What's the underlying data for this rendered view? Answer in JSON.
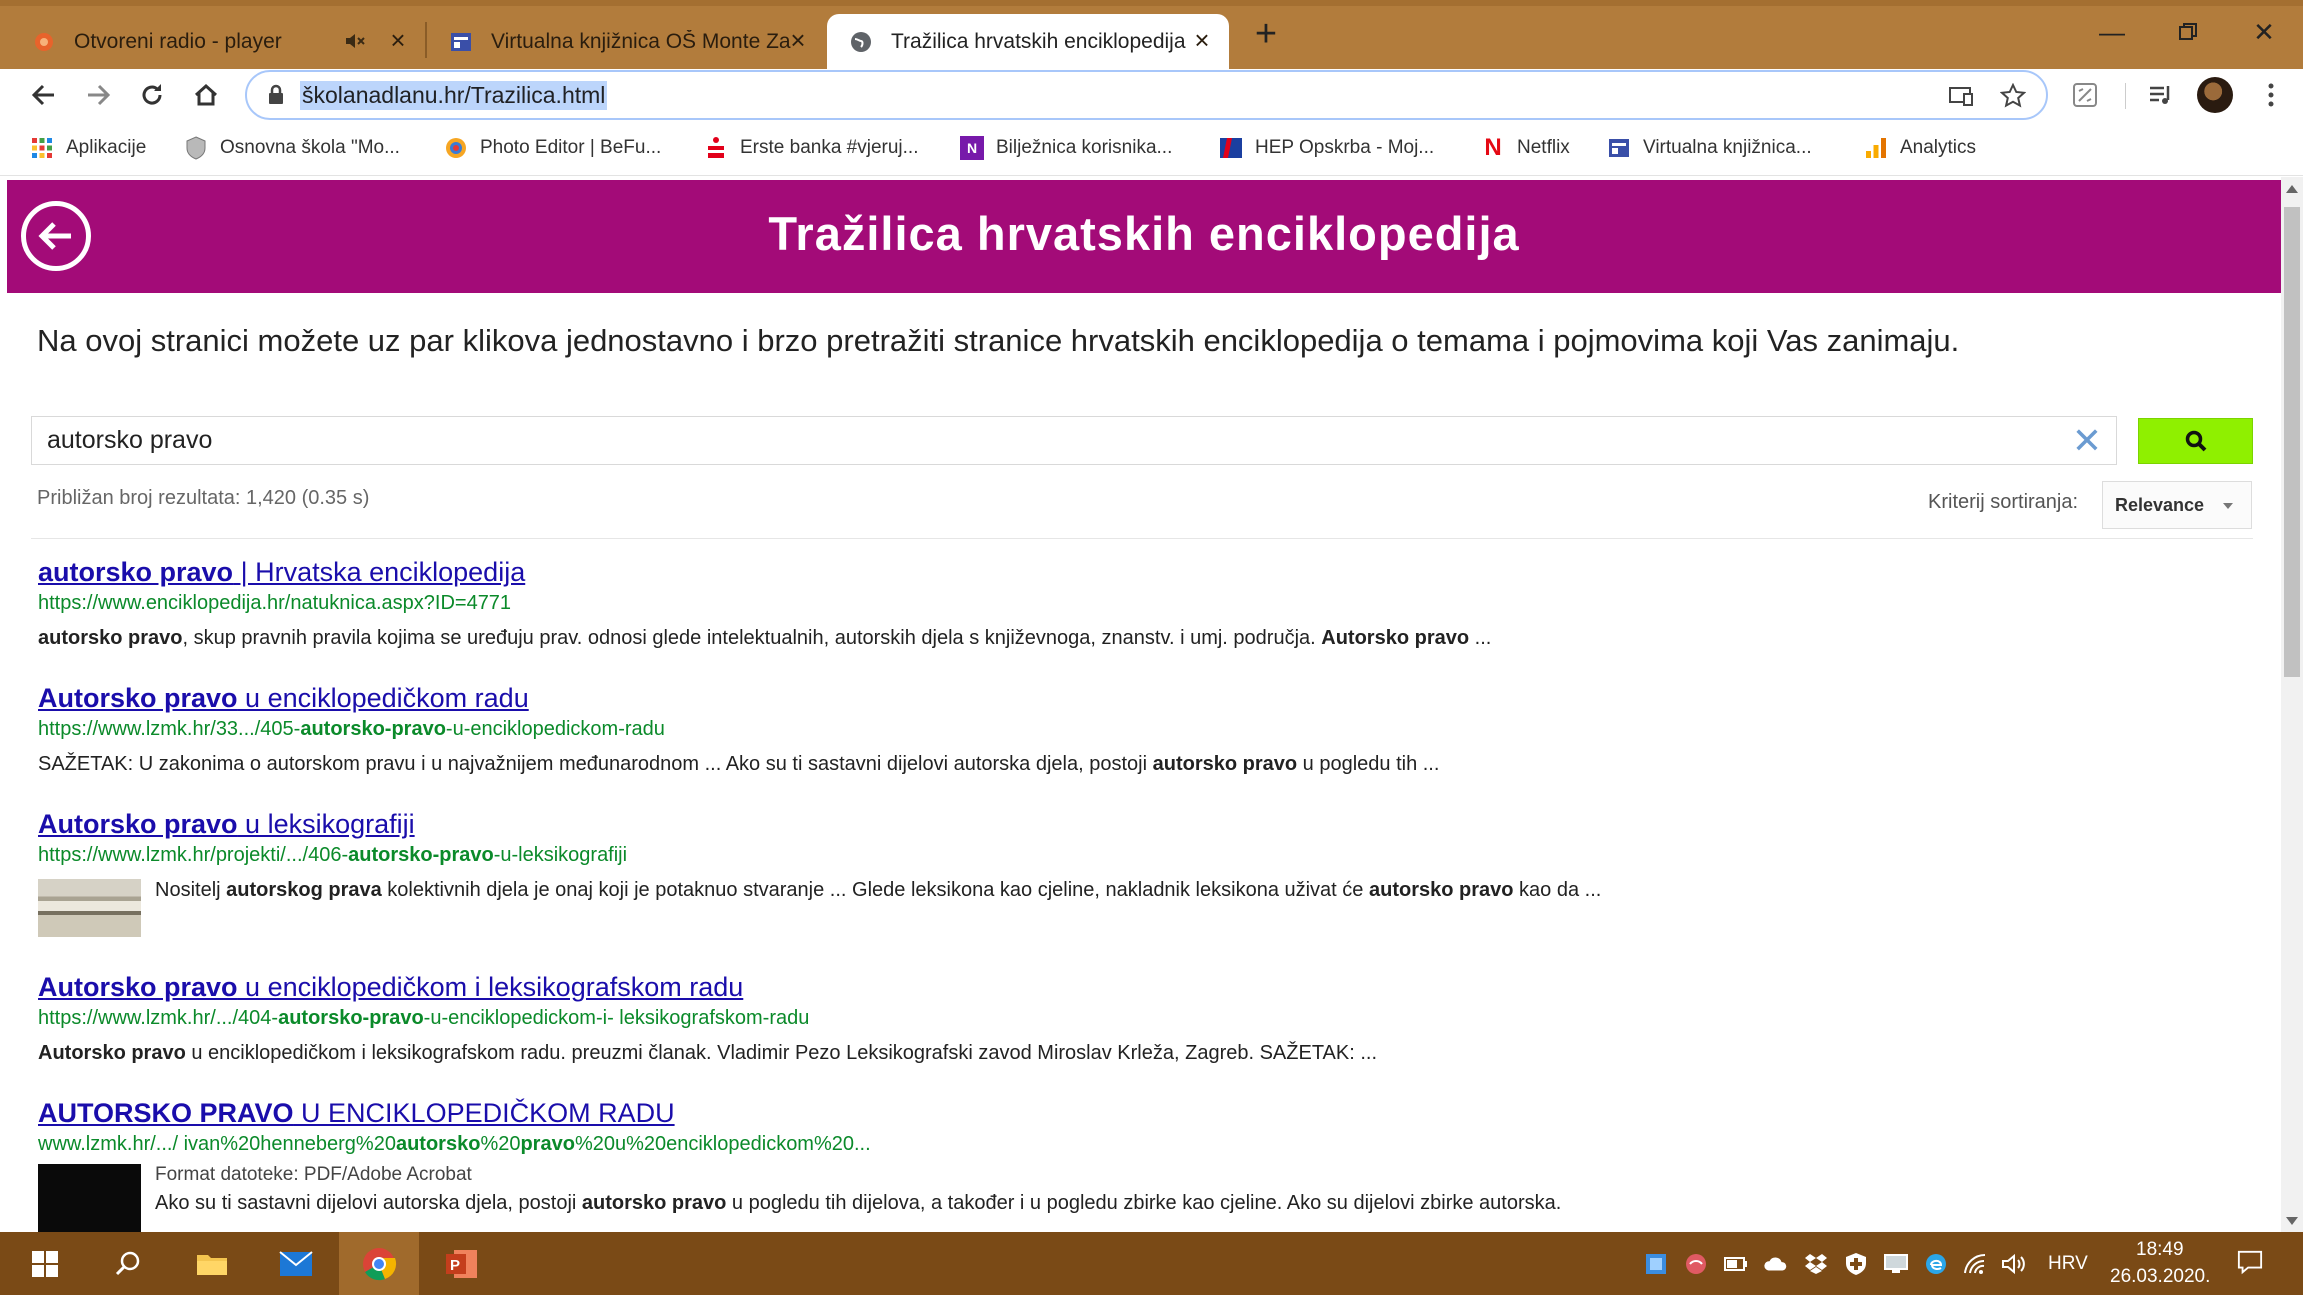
{
  "browser": {
    "tabs": [
      {
        "title": "Otvoreni radio - player",
        "muted_icon": "speaker-icon"
      },
      {
        "title": "Virtualna knjižnica OŠ Monte Zaro"
      },
      {
        "title": "Tražilica hrvatskih enciklopedija",
        "active": true
      }
    ],
    "url": "školanadlanu.hr/Trazilica.html",
    "bookmarks": [
      {
        "label": "Aplikacije",
        "icon": "apps-grid-icon"
      },
      {
        "label": "Osnovna škola \"Mo...",
        "icon": "shield-icon"
      },
      {
        "label": "Photo Editor | BeFu...",
        "icon": "befunky-icon"
      },
      {
        "label": "Erste banka #vjeruj...",
        "icon": "erste-icon"
      },
      {
        "label": "Bilježnica korisnika...",
        "icon": "onenote-icon"
      },
      {
        "label": "HEP Opskrba - Moj...",
        "icon": "hep-icon"
      },
      {
        "label": "Netflix",
        "icon": "netflix-icon"
      },
      {
        "label": "Virtualna knjižnica...",
        "icon": "site-icon"
      },
      {
        "label": "Analytics",
        "icon": "analytics-icon"
      }
    ]
  },
  "page": {
    "header_title": "Tražilica hrvatskih enciklopedija",
    "intro": "Na ovoj stranici možete uz par klikova jednostavno i brzo pretražiti stranice hrvatskih enciklopedija o temama i pojmovima koji Vas zanimaju.",
    "search": {
      "query": "autorsko pravo"
    },
    "result_info": "Približan broj rezultata: 1,420 (0.35 s)",
    "sort_label": "Kriterij sortiranja:",
    "sort_value": "Relevance",
    "results": [
      {
        "title_bold": "autorsko pravo",
        "title_rest": " | Hrvatska enciklopedija",
        "url_pre": "https://www.enciklopedija.hr/natuknica.aspx?ID=4771",
        "url_bold": "",
        "url_post": "",
        "snippet": [
          {
            "b": "autorsko pravo"
          },
          {
            "t": ", skup pravnih pravila kojima se uređuju prav. odnosi glede intelektualnih, autorskih djela s književnoga, znanstv. i umj. područja. "
          },
          {
            "b": "Autorsko pravo"
          },
          {
            "t": " ..."
          }
        ]
      },
      {
        "title_bold": "Autorsko pravo",
        "title_rest": " u enciklopedičkom radu",
        "url_pre": "https://www.lzmk.hr/33.../405-",
        "url_bold": "autorsko-pravo",
        "url_post": "-u-enciklopedickom-radu",
        "snippet": [
          {
            "t": "SAŽETAK: U zakonima o autorskom pravu i u najvažnijem međunarodnom ... Ako su ti sastavni dijelovi autorska djela, postoji "
          },
          {
            "b": "autorsko pravo"
          },
          {
            "t": " u pogledu tih ..."
          }
        ]
      },
      {
        "title_bold": "Autorsko pravo",
        "title_rest": " u leksikografiji",
        "url_pre": "https://www.lzmk.hr/projekti/.../406-",
        "url_bold": "autorsko-pravo",
        "url_post": "-u-leksikografiji",
        "snippet": [
          {
            "t": "Nositelj "
          },
          {
            "b": "autorskog prava"
          },
          {
            "t": " kolektivnih djela je onaj koji je potaknuo stvaranje ... Glede leksikona kao cjeline, nakladnik leksikona uživat će "
          },
          {
            "b": "autorsko pravo"
          },
          {
            "t": " kao da  ..."
          }
        ]
      },
      {
        "title_bold": "Autorsko pravo",
        "title_rest": " u enciklopedičkom i leksikografskom radu",
        "url_pre": "https://www.lzmk.hr/.../404-",
        "url_bold": "autorsko-pravo",
        "url_post": "-u-enciklopedickom-i- leksikografskom-radu",
        "snippet": [
          {
            "b": "Autorsko pravo"
          },
          {
            "t": " u enciklopedičkom i leksikografskom radu. preuzmi članak. Vladimir Pezo Leksikografski zavod Miroslav Krleža, Zagreb. SAŽETAK: ..."
          }
        ]
      },
      {
        "title_bold": "AUTORSKO PRAVO",
        "title_rest": " U ENCIKLOPEDIČKOM RADU",
        "url_pre": "www.lzmk.hr/.../ ivan%20henneberg%20",
        "url_bold": "autorsko",
        "url_post": "%20",
        "url_bold2": "pravo",
        "url_post2": "%20u%20enciklopedickom%20...",
        "format": "Format datoteke: PDF/Adobe Acrobat",
        "snippet": [
          {
            "t": "Ako su ti sastavni dijelovi autorska djela, postoji "
          },
          {
            "b": "autorsko pravo"
          },
          {
            "t": " u pogledu tih dijelova, a također i u pogledu zbirke kao cjeline. Ako su dijelovi zbirke autorska."
          }
        ]
      }
    ]
  },
  "taskbar": {
    "language": "HRV",
    "time": "18:49",
    "date": "26.03.2020."
  },
  "colors": {
    "header": "#a30b78",
    "search_button": "#8ff000",
    "link": "#1a0dab",
    "url_green": "#0b8a2a",
    "tabstrip": "#b27c3c",
    "taskbar": "#7a4a16"
  }
}
